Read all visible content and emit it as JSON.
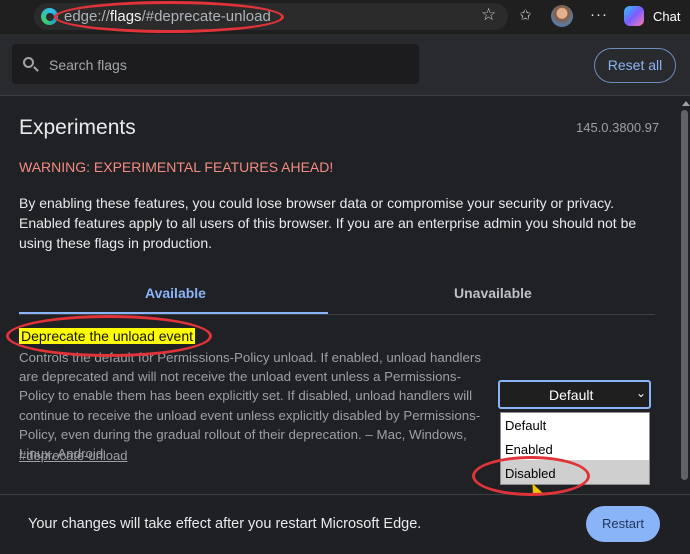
{
  "browser": {
    "url_prefix": "edge://",
    "url_host": "flags",
    "url_path": "/#deprecate-unload",
    "icons": {
      "logo": "edge-logo-icon",
      "favorite": "star-icon",
      "favorites_list": "favorites-icon",
      "profile": "avatar",
      "menu": "more-icon",
      "copilot": "copilot-icon"
    },
    "more_label": "···",
    "chat_label": "Chat"
  },
  "header": {
    "search_placeholder": "Search flags",
    "reset_label": "Reset all"
  },
  "page": {
    "title": "Experiments",
    "version": "145.0.3800.97",
    "warning": "WARNING: EXPERIMENTAL FEATURES AHEAD!",
    "intro": "By enabling these features, you could lose browser data or compromise your security or privacy. Enabled features apply to all users of this browser. If you are an enterprise admin you should not be using these flags in production."
  },
  "tabs": [
    {
      "label": "Available",
      "selected": true
    },
    {
      "label": "Unavailable",
      "selected": false
    }
  ],
  "flag": {
    "title": "Deprecate the unload event",
    "description": "Controls the default for Permissions-Policy unload. If enabled, unload handlers are deprecated and will not receive the unload event unless a Permissions-Policy to enable them has been explicitly set. If disabled, unload handlers will continue to receive the unload event unless explicitly disabled by Permissions-Policy, even during the gradual rollout of their deprecation. – Mac, Windows, Linux, Android",
    "link": "#deprecate-unload",
    "selected_value": "Default",
    "chevron": "⌄",
    "options": [
      "Default",
      "Enabled",
      "Disabled"
    ],
    "highlighted_option": "Disabled"
  },
  "footer": {
    "message": "Your changes will take effect after you restart Microsoft Edge.",
    "restart_label": "Restart"
  },
  "colors": {
    "accent": "#8ab4f8",
    "warning": "#f28b82",
    "highlight": "#ffff00",
    "annotation": "#e0333a"
  }
}
